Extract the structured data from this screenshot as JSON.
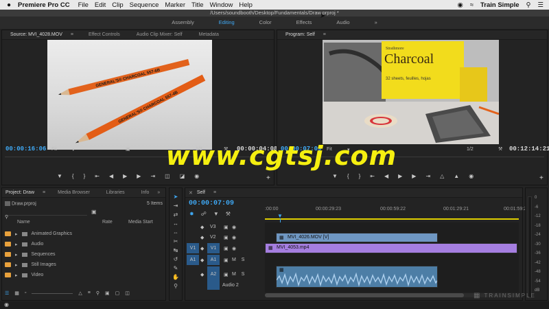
{
  "menubar": {
    "apple": "",
    "app_name": "Premiere Pro CC",
    "items": [
      "File",
      "Edit",
      "Clip",
      "Sequence",
      "Marker",
      "Title",
      "Window",
      "Help"
    ],
    "right_label": "Train Simple"
  },
  "window": {
    "title": "/Users/soundbooth/Desktop/Fundamentals/Draw.prproj *"
  },
  "workspaces": {
    "items": [
      "Assembly",
      "Editing",
      "Color",
      "Effects",
      "Audio"
    ],
    "active": "Editing",
    "more": "»"
  },
  "source_panel": {
    "tabs": [
      "Source: MVI_4028.MOV",
      "Effect Controls",
      "Audio Clip Mixer: Self",
      "Metadata"
    ],
    "timecode": "00:00:16:06",
    "fit": "Fit",
    "resolution": "1/2",
    "duration": "00:00:04:08"
  },
  "program_panel": {
    "tabs": [
      "Program: Self"
    ],
    "timecode": "00:00:07:09",
    "fit": "Fit",
    "resolution": "1/2",
    "duration": "00:12:14:21",
    "pad_brand": "Strathmore",
    "pad_title": "Charcoal",
    "pad_sub": "32 sheets, feuilles, hojas"
  },
  "pencil_text": {
    "pencil1": "GENERAL'S® CHARCOAL 557-6B",
    "pencil2": "GENERAL'S® CHARCOAL 557-4B"
  },
  "project_panel": {
    "tabs": [
      "Project: Draw",
      "Media Browser",
      "Libraries",
      "Info"
    ],
    "file": "Draw.prproj",
    "count": "5 Items",
    "columns": [
      "Name",
      "Rate",
      "Media Start"
    ],
    "bins": [
      "Animated Graphics",
      "Audio",
      "Sequences",
      "Still Images",
      "Video"
    ]
  },
  "timeline": {
    "tab": "Self",
    "timecode": "00:00:07:09",
    "ruler": [
      ":00:00",
      "00:00:29:23",
      "00:00:59:22",
      "00:01:29:21",
      "00:01:59:2"
    ],
    "tracks": [
      {
        "name": "V3",
        "src": "",
        "toggles": ""
      },
      {
        "name": "V2",
        "src": "",
        "toggles": ""
      },
      {
        "name": "V1",
        "src": "V1",
        "toggles": ""
      },
      {
        "name": "A1",
        "src": "A1",
        "toggles": "M S"
      },
      {
        "name": "A2",
        "src": "",
        "toggles": "M S",
        "label": "Audio 2"
      }
    ],
    "clips": {
      "v2": "MVI_4026.MOV [V]",
      "v1": "MVI_4053.mp4"
    }
  },
  "meter": {
    "labels": [
      "0",
      "-6",
      "-12",
      "-18",
      "-24",
      "-30",
      "-36",
      "-42",
      "-48",
      "-54",
      "dB"
    ]
  },
  "overlay": {
    "watermark": "www.cgtsj.com",
    "brand": "TRAINSIMPLE"
  },
  "colors": {
    "accent": "#3fa9f5",
    "clip_v2": "#6f97c2",
    "clip_v1": "#a57ee0",
    "folder": "#e8a13c",
    "watermark": "#f5ef10"
  }
}
